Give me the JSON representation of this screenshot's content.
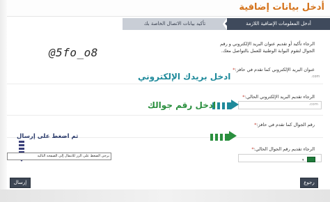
{
  "header": {
    "title": "أدخل بيانات إضافية"
  },
  "wizard": {
    "steps": [
      {
        "label": "أدخل المعلومات الإضافية اللازمة",
        "active": true
      },
      {
        "label": "تأكيد بيانات الاتصال الخاصة بك",
        "active": false
      }
    ]
  },
  "form": {
    "intro": "الرجاء تأكيد أو تقديم عنوان البريد الإلكتروني و رقم الجوال لتقوم البوابة الوطنية للعمل بالتواصل معك.",
    "email_on_file_label": "عنوان البريد الإلكتروني كما تقدم في حافز:",
    "email_on_file_asterisk": "*",
    "email_on_file_hint": ".com",
    "current_email_label": "الرجاء تقديم البريد الإلكتروني الحالي:",
    "current_email_asterisk": "*",
    "current_email_value": ".com",
    "phone_on_file_label": "رقم الجوال كما تقدم في حافز:",
    "phone_on_file_asterisk": "*",
    "current_phone_label": "الرجاء تقديم رقم الجوال الحالي:",
    "current_phone_asterisk": "*"
  },
  "watermark": "@5fo_o8",
  "annotations": {
    "email": "ادخل بريدك الإلكتروني",
    "phone": "ادخل رقم جوالك",
    "submit": "ثم اضغط على إرسال"
  },
  "tooltip": "يرجى الضغط على الزر للانتقال إلى الصفحة التالية",
  "buttons": {
    "submit": "إرسال",
    "back": "رجوع"
  },
  "colors": {
    "title": "#d4721a",
    "step_active": "#3f4a5c",
    "step_inactive": "#c9ced6",
    "annot_email": "#1f8a9b",
    "annot_phone": "#2a8f3e",
    "annot_submit": "#2a3a6a"
  },
  "icons": {
    "flag": "saudi-flag-icon",
    "arrow": "right-arrow-icon",
    "down_arrow": "down-arrow-icon"
  }
}
